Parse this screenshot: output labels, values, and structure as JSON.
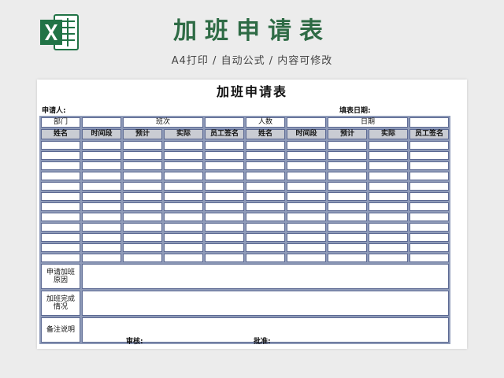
{
  "app": {
    "title": "加班申请表",
    "subtitle": "A4打印 / 自动公式 / 内容可修改",
    "logo_icon": "excel-icon",
    "brand_color": "#217346"
  },
  "sheet": {
    "title": "加班申请表",
    "applicant_label": "申请人:",
    "date_label": "填表日期:",
    "header1": {
      "dept": "部门",
      "shift": "班次",
      "count": "人数",
      "date": "日期"
    },
    "columns": [
      "姓名",
      "时间段",
      "预计",
      "实际",
      "员工签名",
      "姓名",
      "时间段",
      "预计",
      "实际",
      "员工签名"
    ],
    "empty_rows": 12,
    "reason_label": "申请加班原因",
    "completion_label": "加班完成情况",
    "remarks_label": "备注说明",
    "review_label": "审核:",
    "approve_label": "批准:"
  }
}
